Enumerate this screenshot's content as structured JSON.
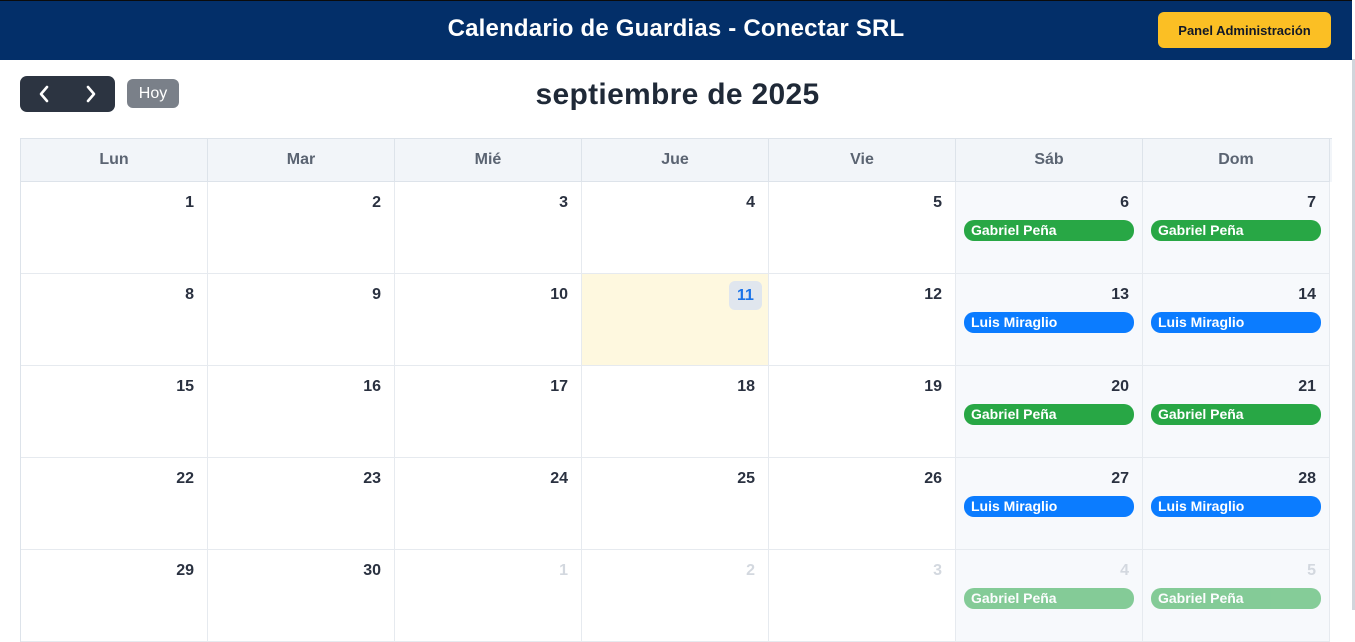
{
  "header": {
    "title": "Calendario de Guardias - Conectar SRL",
    "admin_button": "Panel Administración"
  },
  "toolbar": {
    "prev_icon": "chevron-left-icon",
    "next_icon": "chevron-right-icon",
    "today_label": "Hoy"
  },
  "month_title": "septiembre de 2025",
  "weekdays": [
    "Lun",
    "Mar",
    "Mié",
    "Jue",
    "Vie",
    "Sáb",
    "Dom"
  ],
  "colors": {
    "header": "#032f69",
    "admin_button": "#fbbf24",
    "event_green": "#28a745",
    "event_blue": "#0b7cff",
    "today_bg": "#fef8df"
  },
  "weeks": [
    [
      {
        "day": "1"
      },
      {
        "day": "2"
      },
      {
        "day": "3"
      },
      {
        "day": "4"
      },
      {
        "day": "5"
      },
      {
        "day": "6",
        "event": "Gabriel Peña",
        "color": "green"
      },
      {
        "day": "7",
        "event": "Gabriel Peña",
        "color": "green"
      }
    ],
    [
      {
        "day": "8"
      },
      {
        "day": "9"
      },
      {
        "day": "10"
      },
      {
        "day": "11",
        "today": true
      },
      {
        "day": "12"
      },
      {
        "day": "13",
        "event": "Luis Miraglio",
        "color": "blue"
      },
      {
        "day": "14",
        "event": "Luis Miraglio",
        "color": "blue"
      }
    ],
    [
      {
        "day": "15"
      },
      {
        "day": "16"
      },
      {
        "day": "17"
      },
      {
        "day": "18"
      },
      {
        "day": "19"
      },
      {
        "day": "20",
        "event": "Gabriel Peña",
        "color": "green"
      },
      {
        "day": "21",
        "event": "Gabriel Peña",
        "color": "green"
      }
    ],
    [
      {
        "day": "22"
      },
      {
        "day": "23"
      },
      {
        "day": "24"
      },
      {
        "day": "25"
      },
      {
        "day": "26"
      },
      {
        "day": "27",
        "event": "Luis Miraglio",
        "color": "blue"
      },
      {
        "day": "28",
        "event": "Luis Miraglio",
        "color": "blue"
      }
    ],
    [
      {
        "day": "29"
      },
      {
        "day": "30"
      },
      {
        "day": "1",
        "other": true
      },
      {
        "day": "2",
        "other": true
      },
      {
        "day": "3",
        "other": true
      },
      {
        "day": "4",
        "other": true,
        "event": "Gabriel Peña",
        "color": "green"
      },
      {
        "day": "5",
        "other": true,
        "event": "Gabriel Peña",
        "color": "green"
      }
    ]
  ]
}
